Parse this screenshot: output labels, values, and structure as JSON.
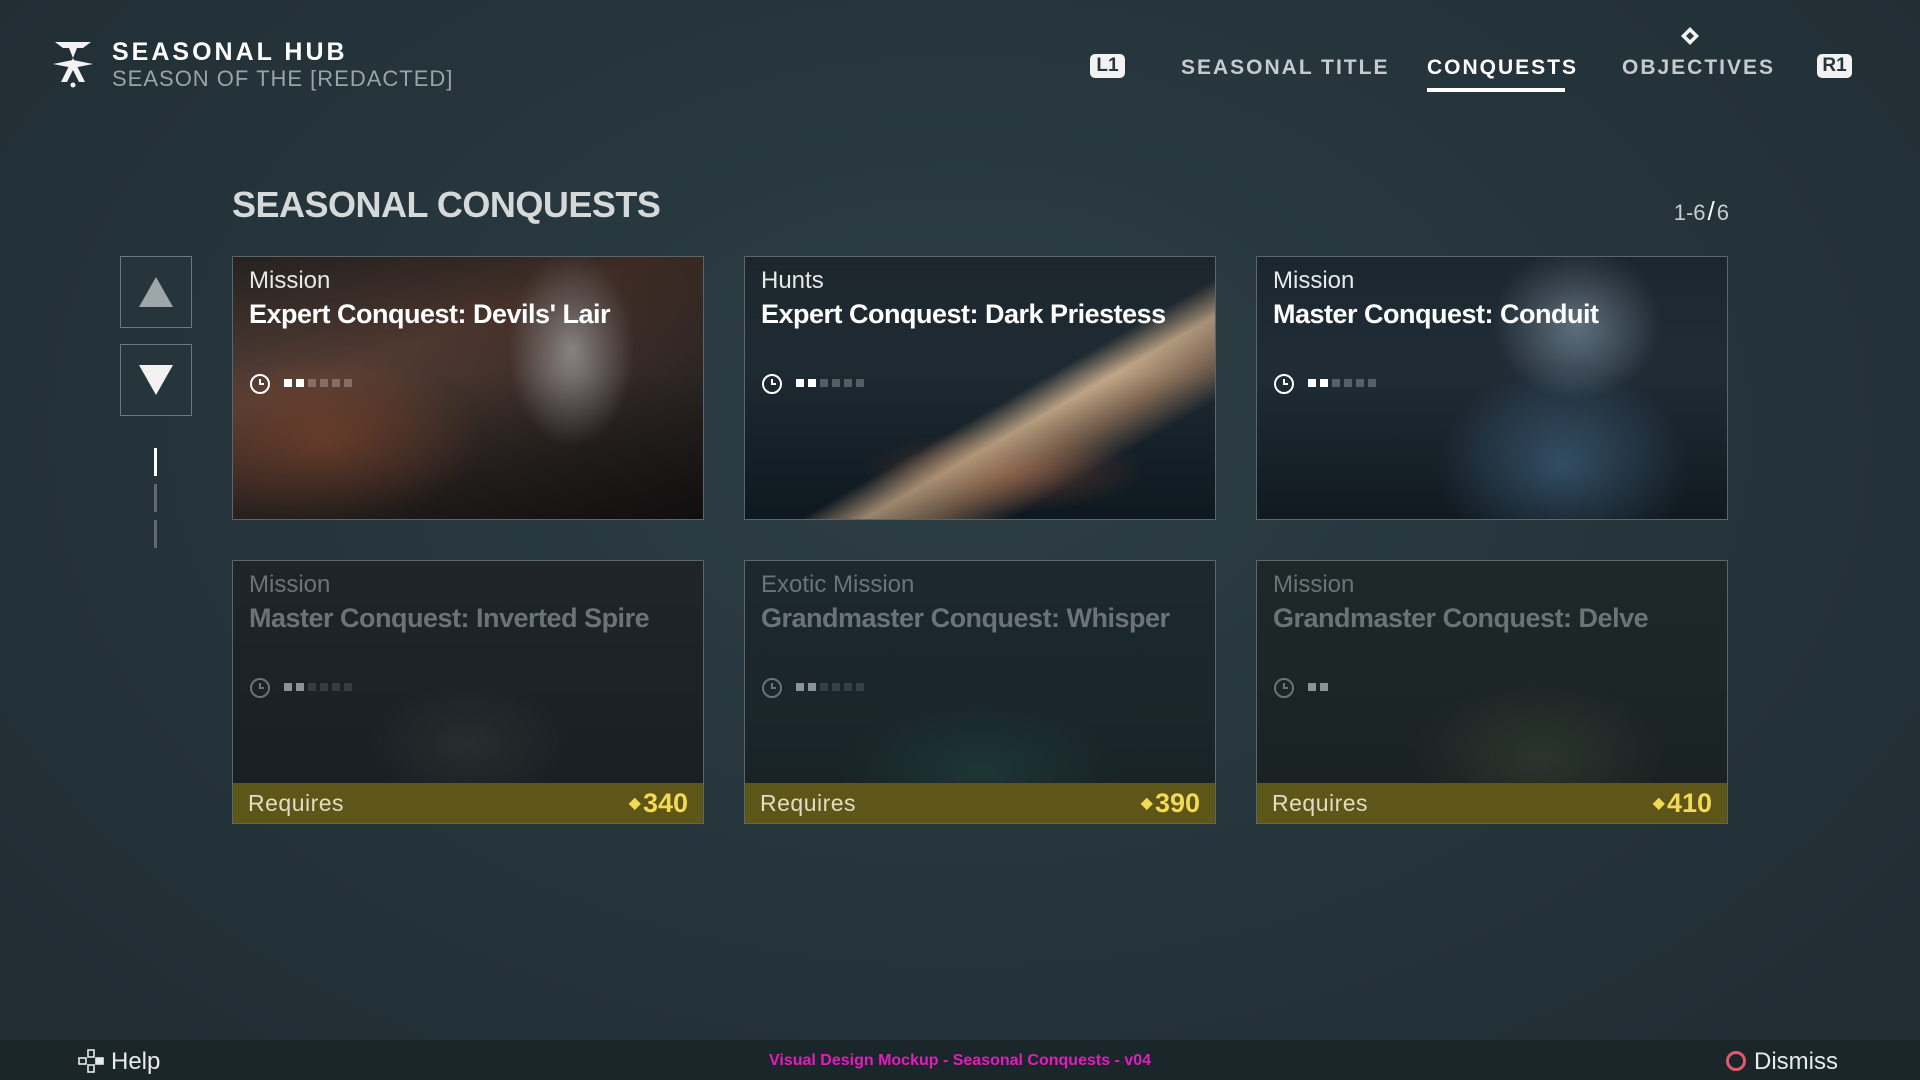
{
  "header": {
    "title": "SEASONAL HUB",
    "subtitle": "SEASON OF THE [REDACTED]",
    "prev_badge": "L1",
    "next_badge": "R1",
    "tabs": [
      {
        "label": "SEASONAL TITLE",
        "active": false
      },
      {
        "label": "CONQUESTS",
        "active": true
      },
      {
        "label": "OBJECTIVES",
        "active": false
      }
    ],
    "logo_icon": "seasonal-emblem-icon"
  },
  "section": {
    "title": "SEASONAL CONQUESTS",
    "page_range": "1-6",
    "page_sep": "/",
    "page_total": "6"
  },
  "side_nav": {
    "up_icon": "triangle-up-icon",
    "down_icon": "triangle-down-icon",
    "pages": 3,
    "current_page": 1
  },
  "cards": [
    {
      "category": "Mission",
      "name": "Expert Conquest: Devils' Lair",
      "locked": false,
      "pips_filled": 2,
      "pips_total": 6
    },
    {
      "category": "Hunts",
      "name": "Expert Conquest: Dark Priestess",
      "locked": false,
      "pips_filled": 2,
      "pips_total": 6
    },
    {
      "category": "Mission",
      "name": "Master Conquest: Conduit",
      "locked": false,
      "pips_filled": 2,
      "pips_total": 6
    },
    {
      "category": "Mission",
      "name": "Master Conquest: Inverted Spire",
      "locked": true,
      "pips_filled": 2,
      "pips_total": 6,
      "requires_label": "Requires",
      "requires_value": "340"
    },
    {
      "category": "Exotic Mission",
      "name": "Grandmaster Conquest: Whisper",
      "locked": true,
      "pips_filled": 2,
      "pips_total": 6,
      "requires_label": "Requires",
      "requires_value": "390"
    },
    {
      "category": "Mission",
      "name": "Grandmaster Conquest: Delve",
      "locked": true,
      "pips_filled": 2,
      "pips_total": 2,
      "requires_label": "Requires",
      "requires_value": "410"
    }
  ],
  "footer": {
    "help_label": "Help",
    "mockup_note": "Visual Design Mockup - Seasonal Conquests - v04",
    "dismiss_label": "Dismiss"
  },
  "colors": {
    "background": "#26353b",
    "requires_bar": "#5e5518",
    "power_yellow": "#f1da54",
    "mockup_magenta": "#e31dbd",
    "dismiss_circle": "#e25a6a"
  }
}
